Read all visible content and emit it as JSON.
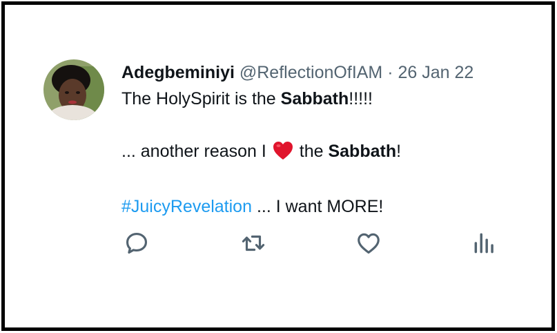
{
  "tweet": {
    "display_name": "Adegbeminiyi",
    "handle": "@ReflectionOfIAM",
    "separator": "·",
    "date": "26 Jan 22",
    "line1": {
      "pre": "The HolySpirit is the ",
      "bold": "Sabbath",
      "post": "!!!!!"
    },
    "line2": {
      "pre": "... another reason I",
      "emoji": "heart-emoji",
      "mid": " the ",
      "bold": "Sabbath",
      "post": "!"
    },
    "line3": {
      "hashtag": "#JuicyRevelation",
      "post": " ... I want MORE!"
    }
  },
  "actions": {
    "reply_icon": "reply-icon",
    "retweet_icon": "retweet-icon",
    "like_icon": "heart-icon",
    "views_icon": "views-icon"
  },
  "colors": {
    "text": "#0f1419",
    "secondary": "#536471",
    "hashtag": "#1d9bf0",
    "heart": "#e0142c",
    "border": "#000000"
  }
}
